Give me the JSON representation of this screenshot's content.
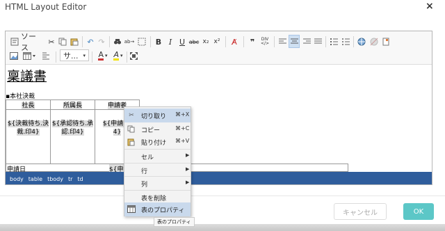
{
  "dialog": {
    "title": "HTML Layout Editor",
    "close_glyph": "×"
  },
  "toolbar": {
    "source_label": "ソース",
    "style_select": "サ...",
    "text_color_label": "A",
    "bg_color_label": "A"
  },
  "document": {
    "heading": "稟議書",
    "subheading": "▪本社決裁",
    "approval_headers": [
      "社長",
      "所属長",
      "申請者"
    ],
    "approval_cells": [
      [
        "${決裁待ち.決",
        "裁.印4}"
      ],
      [
        "${承認待ち.承",
        "認.印4}"
      ],
      [
        "${申請.申",
        "4}"
      ]
    ],
    "row2_label": "申請日",
    "row2_value": "${申請"
  },
  "statusbar": {
    "path": [
      "body",
      "table",
      "tbody",
      "tr",
      "td"
    ]
  },
  "context_menu": {
    "items": [
      {
        "label": "切り取り",
        "shortcut": "⌘+X",
        "icon": "scissors-icon"
      },
      {
        "label": "コピー",
        "shortcut": "⌘+C",
        "icon": "copy-icon"
      },
      {
        "label": "貼り付け",
        "shortcut": "⌘+V",
        "icon": "paste-icon"
      },
      {
        "label": "セル",
        "submenu": true
      },
      {
        "label": "行",
        "submenu": true
      },
      {
        "label": "列",
        "submenu": true
      },
      {
        "label": "表を削除"
      },
      {
        "label": "表のプロパティ",
        "icon": "table-icon"
      }
    ],
    "tooltip": "表のプロパティ"
  },
  "footer": {
    "cancel_label": "キャンセル",
    "ok_label": "OK"
  },
  "colors": {
    "accent": "#5cc7c7",
    "statusbar": "#2f5d9c",
    "menu_highlight": "#c9d9ec"
  }
}
